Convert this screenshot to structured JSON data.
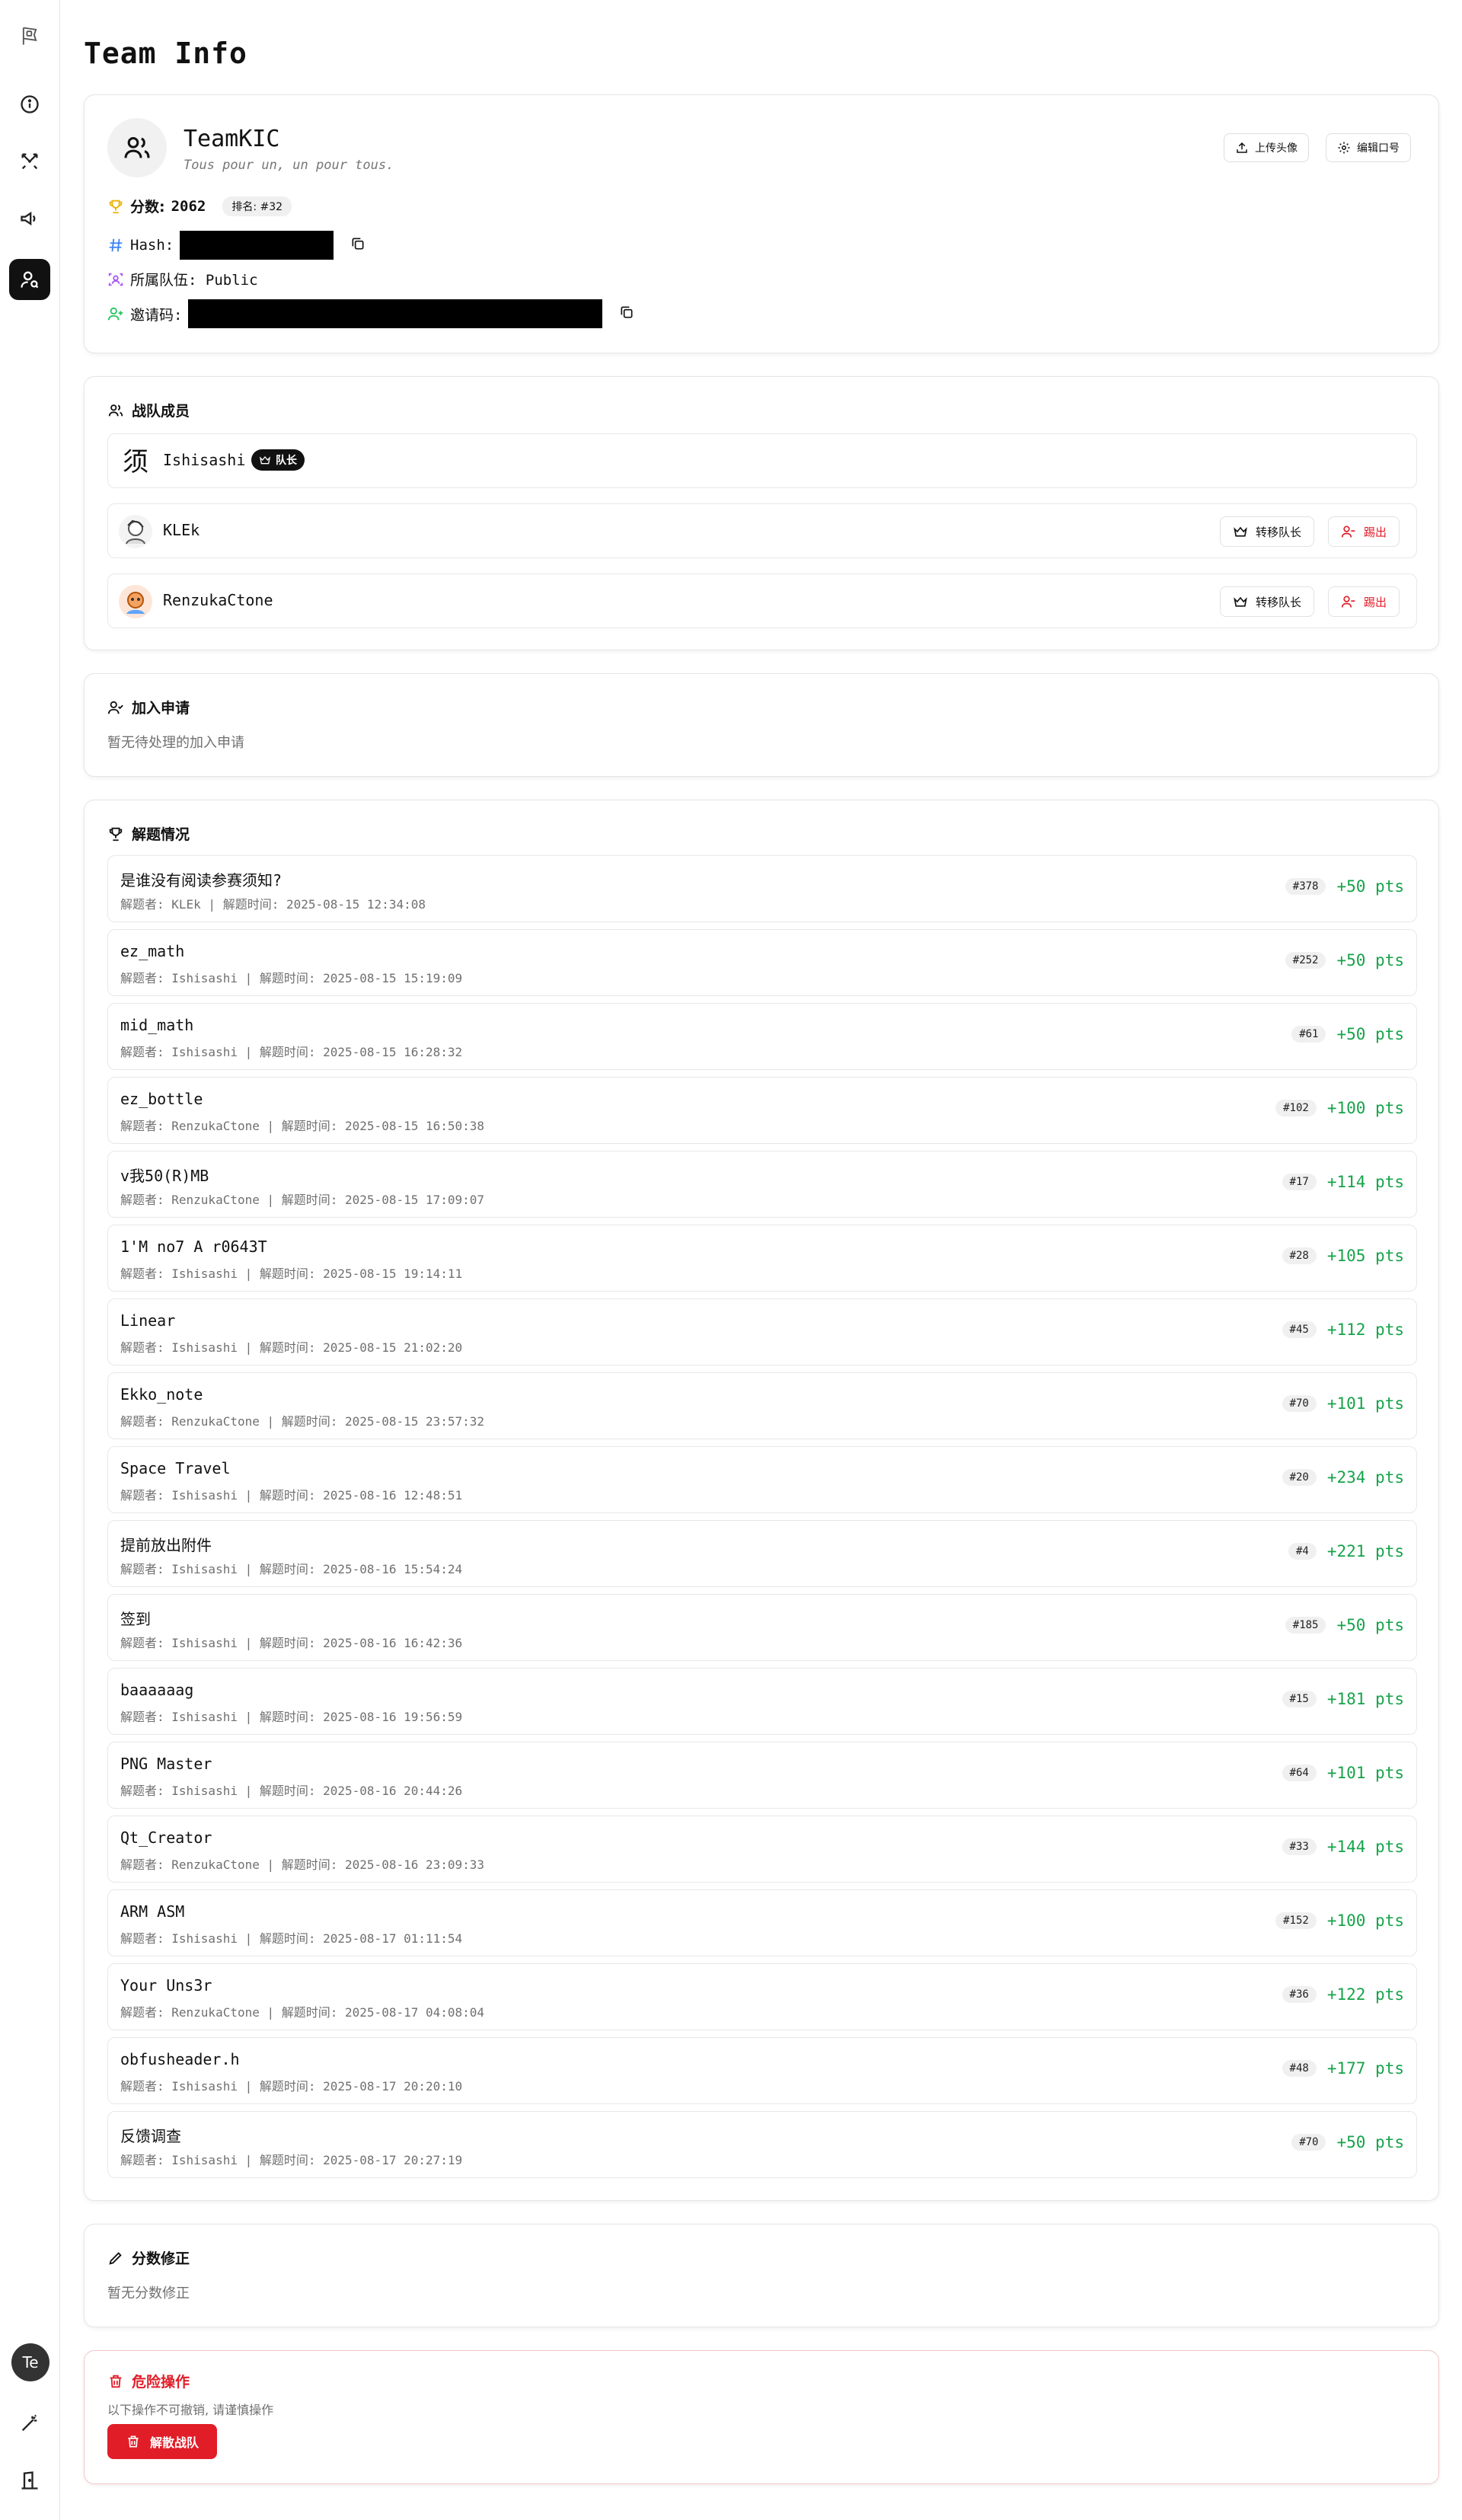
{
  "page": {
    "title": "Team Info"
  },
  "user": {
    "initials": "Te"
  },
  "team": {
    "name": "TeamKIC",
    "motto": "Tous pour un, un pour tous.",
    "upload_avatar_label": "上传头像",
    "edit_motto_label": "编辑口号",
    "score_label": "分数:",
    "score": "2062",
    "rank_label": "排名: #32",
    "hash_label": "Hash:",
    "group_label": "所属队伍: Public",
    "invite_label": "邀请码:"
  },
  "members": {
    "title": "战队成员",
    "leader_badge": "队长",
    "transfer_label": "转移队长",
    "kick_label": "踢出",
    "list": [
      {
        "name": "Ishisashi"
      },
      {
        "name": "KLEk"
      },
      {
        "name": "RenzukaCtone"
      }
    ]
  },
  "join_requests": {
    "title": "加入申请",
    "empty_text": "暂无待处理的加入申请"
  },
  "solves": {
    "title": "解题情况",
    "items": [
      {
        "name": "是谁没有阅读参赛须知?",
        "meta": "解题者: KLEk | 解题时间: 2025-08-15 12:34:08",
        "rank": "#378",
        "pts": "+50 pts"
      },
      {
        "name": "ez_math",
        "meta": "解题者: Ishisashi | 解题时间: 2025-08-15 15:19:09",
        "rank": "#252",
        "pts": "+50 pts"
      },
      {
        "name": "mid_math",
        "meta": "解题者: Ishisashi | 解题时间: 2025-08-15 16:28:32",
        "rank": "#61",
        "pts": "+50 pts"
      },
      {
        "name": "ez_bottle",
        "meta": "解题者: RenzukaCtone | 解题时间: 2025-08-15 16:50:38",
        "rank": "#102",
        "pts": "+100 pts"
      },
      {
        "name": "v我50(R)MB",
        "meta": "解题者: RenzukaCtone | 解题时间: 2025-08-15 17:09:07",
        "rank": "#17",
        "pts": "+114 pts"
      },
      {
        "name": "1'M no7 A r0643T",
        "meta": "解题者: Ishisashi | 解题时间: 2025-08-15 19:14:11",
        "rank": "#28",
        "pts": "+105 pts"
      },
      {
        "name": "Linear",
        "meta": "解题者: Ishisashi | 解题时间: 2025-08-15 21:02:20",
        "rank": "#45",
        "pts": "+112 pts"
      },
      {
        "name": "Ekko_note",
        "meta": "解题者: RenzukaCtone | 解题时间: 2025-08-15 23:57:32",
        "rank": "#70",
        "pts": "+101 pts"
      },
      {
        "name": "Space Travel",
        "meta": "解题者: Ishisashi | 解题时间: 2025-08-16 12:48:51",
        "rank": "#20",
        "pts": "+234 pts"
      },
      {
        "name": "提前放出附件",
        "meta": "解题者: Ishisashi | 解题时间: 2025-08-16 15:54:24",
        "rank": "#4",
        "pts": "+221 pts"
      },
      {
        "name": "签到",
        "meta": "解题者: Ishisashi | 解题时间: 2025-08-16 16:42:36",
        "rank": "#185",
        "pts": "+50 pts"
      },
      {
        "name": "baaaaaag",
        "meta": "解题者: Ishisashi | 解题时间: 2025-08-16 19:56:59",
        "rank": "#15",
        "pts": "+181 pts"
      },
      {
        "name": "PNG Master",
        "meta": "解题者: Ishisashi | 解题时间: 2025-08-16 20:44:26",
        "rank": "#64",
        "pts": "+101 pts"
      },
      {
        "name": "Qt_Creator",
        "meta": "解题者: RenzukaCtone | 解题时间: 2025-08-16 23:09:33",
        "rank": "#33",
        "pts": "+144 pts"
      },
      {
        "name": "ARM ASM",
        "meta": "解题者: Ishisashi | 解题时间: 2025-08-17 01:11:54",
        "rank": "#152",
        "pts": "+100 pts"
      },
      {
        "name": "Your Uns3r",
        "meta": "解题者: RenzukaCtone | 解题时间: 2025-08-17 04:08:04",
        "rank": "#36",
        "pts": "+122 pts"
      },
      {
        "name": "obfusheader.h",
        "meta": "解题者: Ishisashi | 解题时间: 2025-08-17 20:20:10",
        "rank": "#48",
        "pts": "+177 pts"
      },
      {
        "name": "反馈调查",
        "meta": "解题者: Ishisashi | 解题时间: 2025-08-17 20:27:19",
        "rank": "#70",
        "pts": "+50 pts"
      }
    ]
  },
  "score_adjust": {
    "title": "分数修正",
    "empty_text": "暂无分数修正"
  },
  "danger": {
    "title": "危险操作",
    "warning": "以下操作不可撤销, 请谨慎操作",
    "disband_label": "解散战队"
  },
  "colors": {
    "accent": "#111111",
    "points_green": "#16a34a",
    "danger_red": "#e11d28",
    "trophy_yellow": "#eab308",
    "hash_blue": "#3b82f6",
    "group_purple": "#a855f7",
    "invite_green": "#22c55e"
  }
}
